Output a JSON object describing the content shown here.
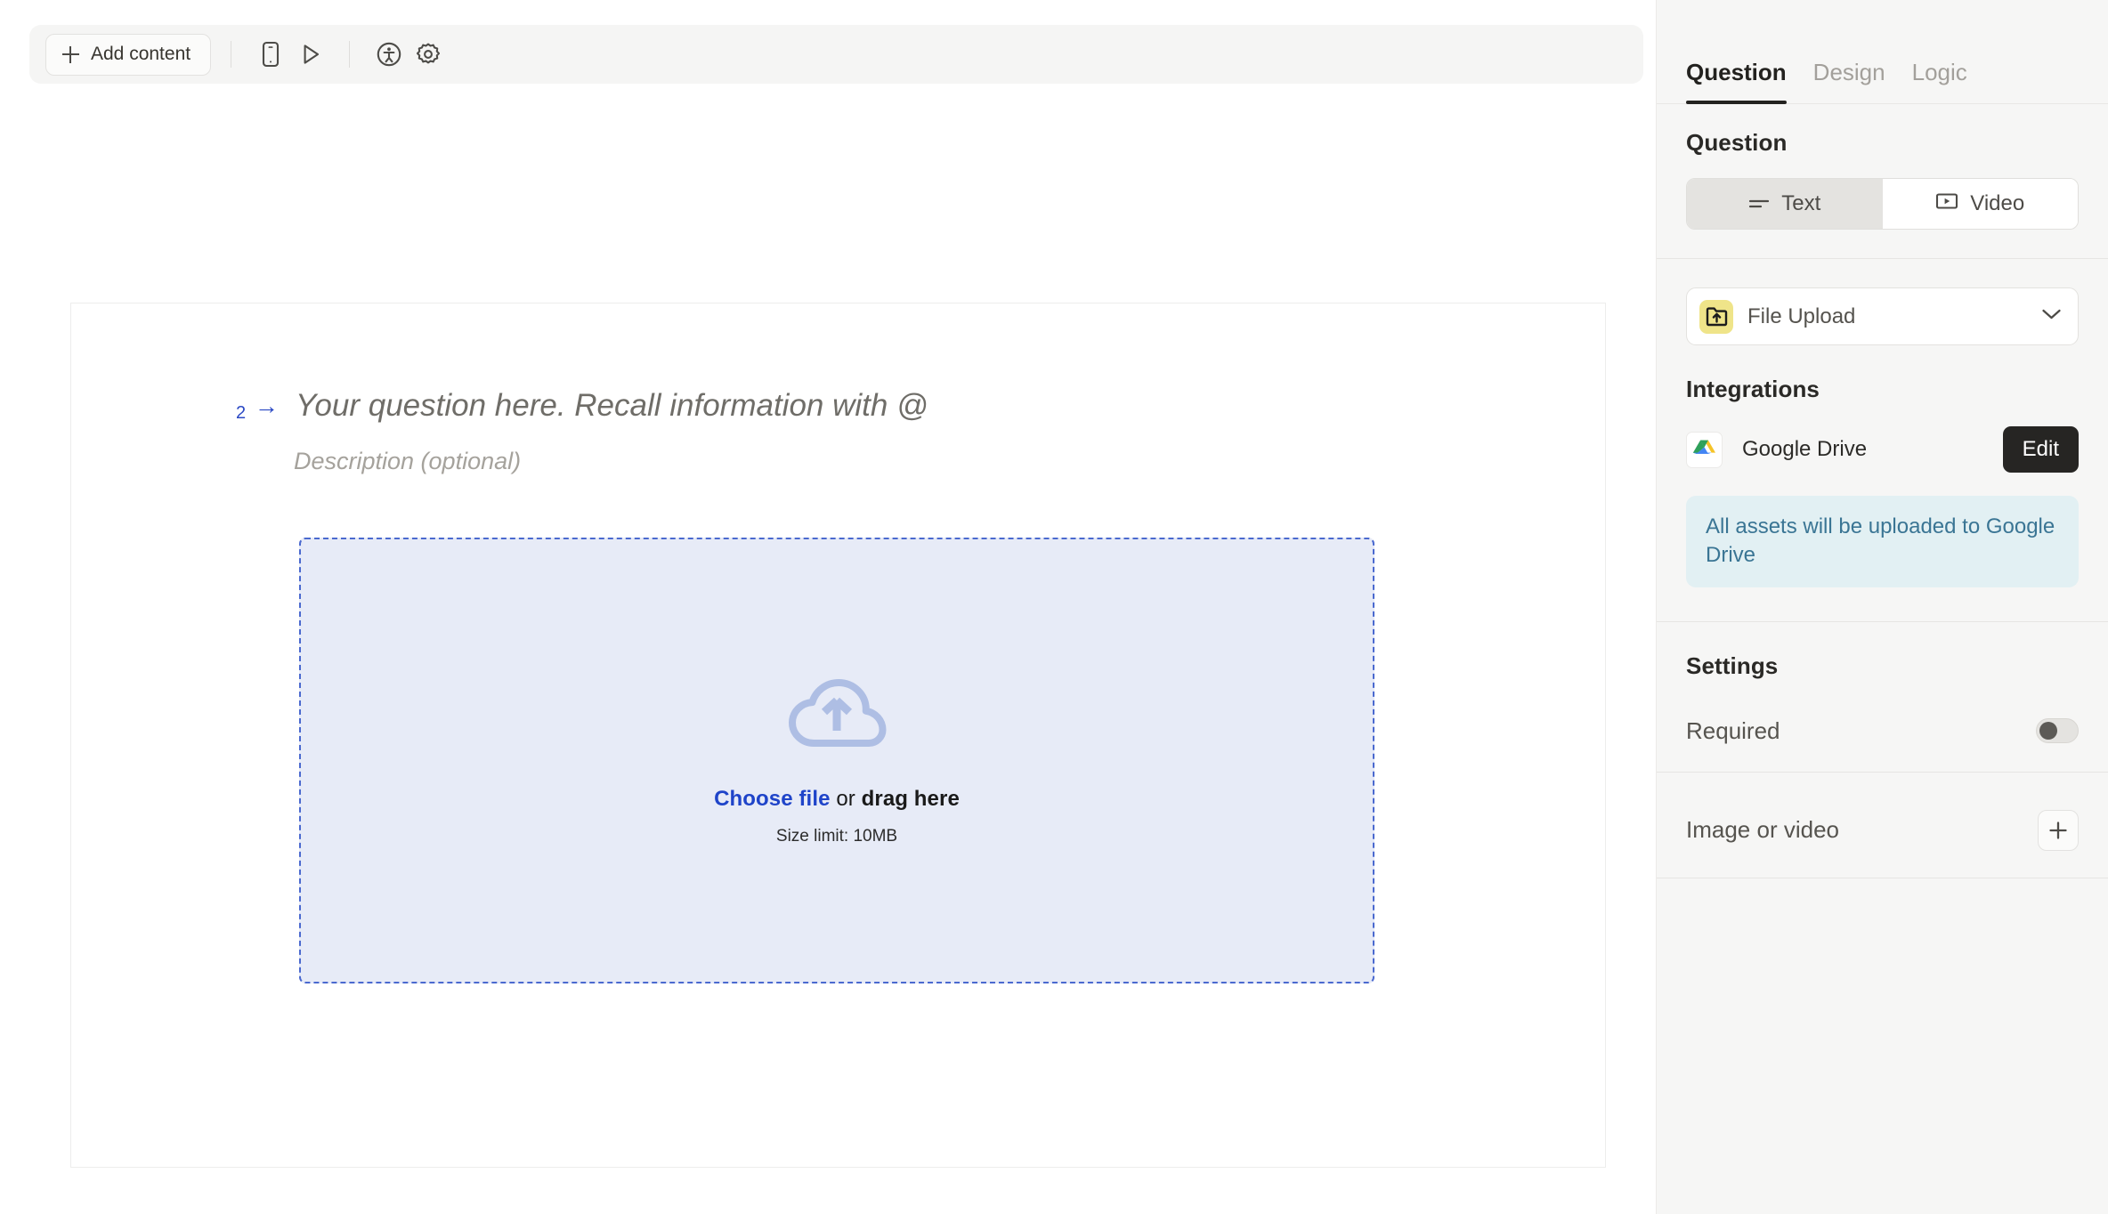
{
  "toolbar": {
    "add_content_label": "Add content",
    "icons": [
      {
        "name": "mobile-preview-icon",
        "title": "mobile-preview"
      },
      {
        "name": "play-preview-icon",
        "title": "preview"
      },
      {
        "name": "accessibility-icon",
        "title": "accessibility"
      },
      {
        "name": "settings-gear-icon",
        "title": "settings"
      }
    ]
  },
  "canvas": {
    "question_number": "2",
    "arrow": "→",
    "question_placeholder": "Your question here. Recall information with @",
    "description_placeholder": "Description (optional)",
    "dropzone": {
      "icon": "cloud-upload-icon",
      "link_text": "Choose file",
      "mid_text": " or ",
      "bold_text": "drag here",
      "size_limit": "Size limit: 10MB",
      "border_color": "#4a69cf",
      "background_color": "#e7ebf7"
    }
  },
  "panel": {
    "tabs": [
      {
        "label": "Question",
        "active": true
      },
      {
        "label": "Design",
        "active": false
      },
      {
        "label": "Logic",
        "active": false
      }
    ],
    "question_section": {
      "title": "Question",
      "segmented": [
        {
          "label": "Text",
          "icon": "text-lines-icon",
          "active": true
        },
        {
          "label": "Video",
          "icon": "video-play-icon",
          "active": false
        }
      ],
      "type_dropdown": {
        "label": "File Upload",
        "icon": "folder-upload-icon",
        "icon_bg": "#efe489",
        "chevron": "chevron-down-icon"
      }
    },
    "integrations_section": {
      "title": "Integrations",
      "item": {
        "name": "Google Drive",
        "icon": "google-drive-icon",
        "action_label": "Edit"
      },
      "info_text": "All assets will be uploaded to Google Drive",
      "info_bg": "#e2f0f3",
      "info_color": "#3a7594"
    },
    "settings_section": {
      "title": "Settings",
      "required_label": "Required",
      "required_value": "off",
      "image_or_video_label": "Image or video",
      "add_label": "+"
    }
  }
}
